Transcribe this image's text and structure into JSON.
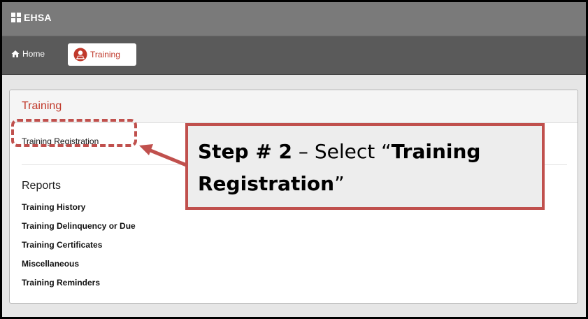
{
  "app": {
    "title": "EHSA"
  },
  "nav": {
    "home_label": "Home",
    "training_label": "Training"
  },
  "panel": {
    "title": "Training",
    "registration_link": "Training Registration",
    "reports_heading": "Reports",
    "reports": [
      "Training History",
      "Training Delinquency or Due",
      "Training Certificates",
      "Miscellaneous",
      "Training Reminders"
    ]
  },
  "callout": {
    "step_bold": "Step # 2",
    "step_rest": " – Select “",
    "target_bold": "Training Registration",
    "closing": "”"
  },
  "colors": {
    "accent": "#c0504d",
    "brand_red": "#c0392b",
    "titlebar": "#7a7a7a",
    "navbar": "#5a5a5a"
  },
  "icons": {
    "logo": "grid-logo-icon",
    "home": "home-icon",
    "training": "training-person-icon"
  }
}
